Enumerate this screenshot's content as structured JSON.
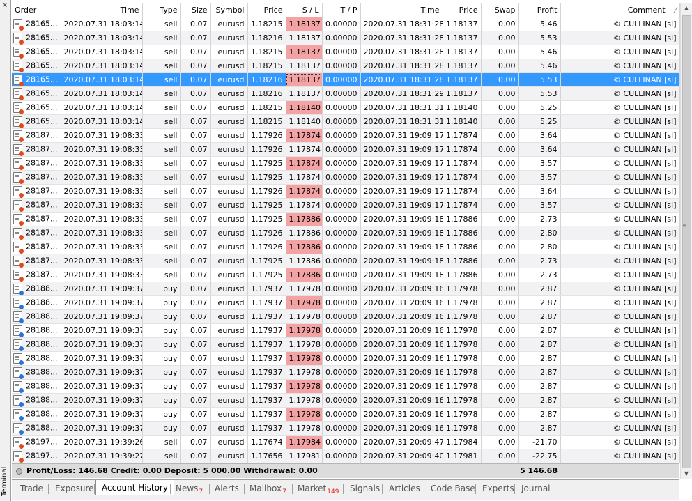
{
  "side": {
    "label": "Terminal",
    "close_glyph": "×"
  },
  "columns": [
    "Order",
    "Time",
    "Type",
    "Size",
    "Symbol",
    "Price",
    "S / L",
    "T / P",
    "Time",
    "Price",
    "Swap",
    "Profit",
    "Comment"
  ],
  "sort_indicator": "⁄",
  "rows": [
    {
      "order": "28165...",
      "time": "2020.07.31 18:03:14",
      "type": "sell",
      "size": "0.07",
      "symbol": "eurusd",
      "price": "1.18215",
      "sl": "1.18137",
      "tp": "0.00000",
      "close_time": "2020.07.31 18:31:28",
      "close_price": "1.18137",
      "swap": "0.00",
      "profit": "5.46",
      "comment": "© CULLINAN [sl]"
    },
    {
      "order": "28165...",
      "time": "2020.07.31 18:03:14",
      "type": "sell",
      "size": "0.07",
      "symbol": "eurusd",
      "price": "1.18216",
      "sl": "1.18137",
      "tp": "0.00000",
      "close_time": "2020.07.31 18:31:28",
      "close_price": "1.18137",
      "swap": "0.00",
      "profit": "5.53",
      "comment": "© CULLINAN [sl]"
    },
    {
      "order": "28165...",
      "time": "2020.07.31 18:03:14",
      "type": "sell",
      "size": "0.07",
      "symbol": "eurusd",
      "price": "1.18215",
      "sl": "1.18137",
      "tp": "0.00000",
      "close_time": "2020.07.31 18:31:28",
      "close_price": "1.18137",
      "swap": "0.00",
      "profit": "5.46",
      "comment": "© CULLINAN [sl]"
    },
    {
      "order": "28165...",
      "time": "2020.07.31 18:03:14",
      "type": "sell",
      "size": "0.07",
      "symbol": "eurusd",
      "price": "1.18215",
      "sl": "1.18137",
      "tp": "0.00000",
      "close_time": "2020.07.31 18:31:28",
      "close_price": "1.18137",
      "swap": "0.00",
      "profit": "5.46",
      "comment": "© CULLINAN [sl]"
    },
    {
      "order": "28165...",
      "time": "2020.07.31 18:03:14",
      "type": "sell",
      "size": "0.07",
      "symbol": "eurusd",
      "price": "1.18216",
      "sl": "1.18137",
      "tp": "0.00000",
      "close_time": "2020.07.31 18:31:28",
      "close_price": "1.18137",
      "swap": "0.00",
      "profit": "5.53",
      "comment": "© CULLINAN [sl]",
      "selected": true
    },
    {
      "order": "28165...",
      "time": "2020.07.31 18:03:14",
      "type": "sell",
      "size": "0.07",
      "symbol": "eurusd",
      "price": "1.18216",
      "sl": "1.18137",
      "tp": "0.00000",
      "close_time": "2020.07.31 18:31:29",
      "close_price": "1.18137",
      "swap": "0.00",
      "profit": "5.53",
      "comment": "© CULLINAN [sl]"
    },
    {
      "order": "28165...",
      "time": "2020.07.31 18:03:14",
      "type": "sell",
      "size": "0.07",
      "symbol": "eurusd",
      "price": "1.18215",
      "sl": "1.18140",
      "tp": "0.00000",
      "close_time": "2020.07.31 18:31:31",
      "close_price": "1.18140",
      "swap": "0.00",
      "profit": "5.25",
      "comment": "© CULLINAN [sl]"
    },
    {
      "order": "28165...",
      "time": "2020.07.31 18:03:14",
      "type": "sell",
      "size": "0.07",
      "symbol": "eurusd",
      "price": "1.18215",
      "sl": "1.18140",
      "tp": "0.00000",
      "close_time": "2020.07.31 18:31:31",
      "close_price": "1.18140",
      "swap": "0.00",
      "profit": "5.25",
      "comment": "© CULLINAN [sl]"
    },
    {
      "order": "28187...",
      "time": "2020.07.31 19:08:33",
      "type": "sell",
      "size": "0.07",
      "symbol": "eurusd",
      "price": "1.17926",
      "sl": "1.17874",
      "tp": "0.00000",
      "close_time": "2020.07.31 19:09:17",
      "close_price": "1.17874",
      "swap": "0.00",
      "profit": "3.64",
      "comment": "© CULLINAN [sl]"
    },
    {
      "order": "28187...",
      "time": "2020.07.31 19:08:33",
      "type": "sell",
      "size": "0.07",
      "symbol": "eurusd",
      "price": "1.17926",
      "sl": "1.17874",
      "tp": "0.00000",
      "close_time": "2020.07.31 19:09:17",
      "close_price": "1.17874",
      "swap": "0.00",
      "profit": "3.64",
      "comment": "© CULLINAN [sl]"
    },
    {
      "order": "28187...",
      "time": "2020.07.31 19:08:33",
      "type": "sell",
      "size": "0.07",
      "symbol": "eurusd",
      "price": "1.17925",
      "sl": "1.17874",
      "tp": "0.00000",
      "close_time": "2020.07.31 19:09:17",
      "close_price": "1.17874",
      "swap": "0.00",
      "profit": "3.57",
      "comment": "© CULLINAN [sl]"
    },
    {
      "order": "28187...",
      "time": "2020.07.31 19:08:33",
      "type": "sell",
      "size": "0.07",
      "symbol": "eurusd",
      "price": "1.17925",
      "sl": "1.17874",
      "tp": "0.00000",
      "close_time": "2020.07.31 19:09:17",
      "close_price": "1.17874",
      "swap": "0.00",
      "profit": "3.57",
      "comment": "© CULLINAN [sl]"
    },
    {
      "order": "28187...",
      "time": "2020.07.31 19:08:33",
      "type": "sell",
      "size": "0.07",
      "symbol": "eurusd",
      "price": "1.17926",
      "sl": "1.17874",
      "tp": "0.00000",
      "close_time": "2020.07.31 19:09:17",
      "close_price": "1.17874",
      "swap": "0.00",
      "profit": "3.64",
      "comment": "© CULLINAN [sl]"
    },
    {
      "order": "28187...",
      "time": "2020.07.31 19:08:33",
      "type": "sell",
      "size": "0.07",
      "symbol": "eurusd",
      "price": "1.17925",
      "sl": "1.17874",
      "tp": "0.00000",
      "close_time": "2020.07.31 19:09:17",
      "close_price": "1.17874",
      "swap": "0.00",
      "profit": "3.57",
      "comment": "© CULLINAN [sl]"
    },
    {
      "order": "28187...",
      "time": "2020.07.31 19:08:33",
      "type": "sell",
      "size": "0.07",
      "symbol": "eurusd",
      "price": "1.17925",
      "sl": "1.17886",
      "tp": "0.00000",
      "close_time": "2020.07.31 19:09:18",
      "close_price": "1.17886",
      "swap": "0.00",
      "profit": "2.73",
      "comment": "© CULLINAN [sl]"
    },
    {
      "order": "28187...",
      "time": "2020.07.31 19:08:33",
      "type": "sell",
      "size": "0.07",
      "symbol": "eurusd",
      "price": "1.17926",
      "sl": "1.17886",
      "tp": "0.00000",
      "close_time": "2020.07.31 19:09:18",
      "close_price": "1.17886",
      "swap": "0.00",
      "profit": "2.80",
      "comment": "© CULLINAN [sl]"
    },
    {
      "order": "28187...",
      "time": "2020.07.31 19:08:33",
      "type": "sell",
      "size": "0.07",
      "symbol": "eurusd",
      "price": "1.17926",
      "sl": "1.17886",
      "tp": "0.00000",
      "close_time": "2020.07.31 19:09:18",
      "close_price": "1.17886",
      "swap": "0.00",
      "profit": "2.80",
      "comment": "© CULLINAN [sl]"
    },
    {
      "order": "28187...",
      "time": "2020.07.31 19:08:33",
      "type": "sell",
      "size": "0.07",
      "symbol": "eurusd",
      "price": "1.17925",
      "sl": "1.17886",
      "tp": "0.00000",
      "close_time": "2020.07.31 19:09:18",
      "close_price": "1.17886",
      "swap": "0.00",
      "profit": "2.73",
      "comment": "© CULLINAN [sl]"
    },
    {
      "order": "28187...",
      "time": "2020.07.31 19:08:33",
      "type": "sell",
      "size": "0.07",
      "symbol": "eurusd",
      "price": "1.17925",
      "sl": "1.17886",
      "tp": "0.00000",
      "close_time": "2020.07.31 19:09:18",
      "close_price": "1.17886",
      "swap": "0.00",
      "profit": "2.73",
      "comment": "© CULLINAN [sl]"
    },
    {
      "order": "28188...",
      "time": "2020.07.31 19:09:37",
      "type": "buy",
      "size": "0.07",
      "symbol": "eurusd",
      "price": "1.17937",
      "sl": "1.17978",
      "tp": "0.00000",
      "close_time": "2020.07.31 20:09:16",
      "close_price": "1.17978",
      "swap": "0.00",
      "profit": "2.87",
      "comment": "© CULLINAN [sl]"
    },
    {
      "order": "28188...",
      "time": "2020.07.31 19:09:37",
      "type": "buy",
      "size": "0.07",
      "symbol": "eurusd",
      "price": "1.17937",
      "sl": "1.17978",
      "tp": "0.00000",
      "close_time": "2020.07.31 20:09:16",
      "close_price": "1.17978",
      "swap": "0.00",
      "profit": "2.87",
      "comment": "© CULLINAN [sl]"
    },
    {
      "order": "28188...",
      "time": "2020.07.31 19:09:37",
      "type": "buy",
      "size": "0.07",
      "symbol": "eurusd",
      "price": "1.17937",
      "sl": "1.17978",
      "tp": "0.00000",
      "close_time": "2020.07.31 20:09:16",
      "close_price": "1.17978",
      "swap": "0.00",
      "profit": "2.87",
      "comment": "© CULLINAN [sl]"
    },
    {
      "order": "28188...",
      "time": "2020.07.31 19:09:37",
      "type": "buy",
      "size": "0.07",
      "symbol": "eurusd",
      "price": "1.17937",
      "sl": "1.17978",
      "tp": "0.00000",
      "close_time": "2020.07.31 20:09:16",
      "close_price": "1.17978",
      "swap": "0.00",
      "profit": "2.87",
      "comment": "© CULLINAN [sl]"
    },
    {
      "order": "28188...",
      "time": "2020.07.31 19:09:37",
      "type": "buy",
      "size": "0.07",
      "symbol": "eurusd",
      "price": "1.17937",
      "sl": "1.17978",
      "tp": "0.00000",
      "close_time": "2020.07.31 20:09:16",
      "close_price": "1.17978",
      "swap": "0.00",
      "profit": "2.87",
      "comment": "© CULLINAN [sl]"
    },
    {
      "order": "28188...",
      "time": "2020.07.31 19:09:37",
      "type": "buy",
      "size": "0.07",
      "symbol": "eurusd",
      "price": "1.17937",
      "sl": "1.17978",
      "tp": "0.00000",
      "close_time": "2020.07.31 20:09:16",
      "close_price": "1.17978",
      "swap": "0.00",
      "profit": "2.87",
      "comment": "© CULLINAN [sl]"
    },
    {
      "order": "28188...",
      "time": "2020.07.31 19:09:37",
      "type": "buy",
      "size": "0.07",
      "symbol": "eurusd",
      "price": "1.17937",
      "sl": "1.17978",
      "tp": "0.00000",
      "close_time": "2020.07.31 20:09:16",
      "close_price": "1.17978",
      "swap": "0.00",
      "profit": "2.87",
      "comment": "© CULLINAN [sl]"
    },
    {
      "order": "28188...",
      "time": "2020.07.31 19:09:37",
      "type": "buy",
      "size": "0.07",
      "symbol": "eurusd",
      "price": "1.17937",
      "sl": "1.17978",
      "tp": "0.00000",
      "close_time": "2020.07.31 20:09:16",
      "close_price": "1.17978",
      "swap": "0.00",
      "profit": "2.87",
      "comment": "© CULLINAN [sl]"
    },
    {
      "order": "28188...",
      "time": "2020.07.31 19:09:37",
      "type": "buy",
      "size": "0.07",
      "symbol": "eurusd",
      "price": "1.17937",
      "sl": "1.17978",
      "tp": "0.00000",
      "close_time": "2020.07.31 20:09:16",
      "close_price": "1.17978",
      "swap": "0.00",
      "profit": "2.87",
      "comment": "© CULLINAN [sl]"
    },
    {
      "order": "28188...",
      "time": "2020.07.31 19:09:37",
      "type": "buy",
      "size": "0.07",
      "symbol": "eurusd",
      "price": "1.17937",
      "sl": "1.17978",
      "tp": "0.00000",
      "close_time": "2020.07.31 20:09:16",
      "close_price": "1.17978",
      "swap": "0.00",
      "profit": "2.87",
      "comment": "© CULLINAN [sl]"
    },
    {
      "order": "28188...",
      "time": "2020.07.31 19:09:37",
      "type": "buy",
      "size": "0.07",
      "symbol": "eurusd",
      "price": "1.17937",
      "sl": "1.17978",
      "tp": "0.00000",
      "close_time": "2020.07.31 20:09:16",
      "close_price": "1.17978",
      "swap": "0.00",
      "profit": "2.87",
      "comment": "© CULLINAN [sl]"
    },
    {
      "order": "28197...",
      "time": "2020.07.31 19:39:26",
      "type": "sell",
      "size": "0.07",
      "symbol": "eurusd",
      "price": "1.17674",
      "sl": "1.17984",
      "tp": "0.00000",
      "close_time": "2020.07.31 20:09:47",
      "close_price": "1.17984",
      "swap": "0.00",
      "profit": "-21.70",
      "comment": "© CULLINAN [sl]"
    },
    {
      "order": "28197...",
      "time": "2020.07.31 19:39:27",
      "type": "sell",
      "size": "0.07",
      "symbol": "eurusd",
      "price": "1.17656",
      "sl": "1.17981",
      "tp": "0.00000",
      "close_time": "2020.07.31 20:09:40",
      "close_price": "1.17981",
      "swap": "0.00",
      "profit": "-22.75",
      "comment": "© CULLINAN [sl]"
    }
  ],
  "summary": {
    "text": "Profit/Loss: 146.68  Credit: 0.00  Deposit: 5 000.00  Withdrawal: 0.00",
    "balance": "5 146.68"
  },
  "tabs": [
    {
      "label": "Trade",
      "badge": ""
    },
    {
      "label": "Exposure",
      "badge": ""
    },
    {
      "label": "Account History",
      "badge": "",
      "active": true
    },
    {
      "label": "News",
      "badge": "7"
    },
    {
      "label": "Alerts",
      "badge": ""
    },
    {
      "label": "Mailbox",
      "badge": "7"
    },
    {
      "label": "Market",
      "badge": "149"
    },
    {
      "label": "Signals",
      "badge": ""
    },
    {
      "label": "Articles",
      "badge": ""
    },
    {
      "label": "Code Base",
      "badge": ""
    },
    {
      "label": "Experts",
      "badge": ""
    },
    {
      "label": "Journal",
      "badge": ""
    }
  ],
  "colors": {
    "selected_row": "#3399ff",
    "sl_cell": "#f3a3a3",
    "sell_dot": "#e04b1d",
    "buy_dot": "#2a74d9"
  },
  "icons": {
    "order": "order-document-icon",
    "scroll_up": "scroll-up-arrow-icon",
    "scroll_down": "scroll-down-arrow-icon"
  }
}
